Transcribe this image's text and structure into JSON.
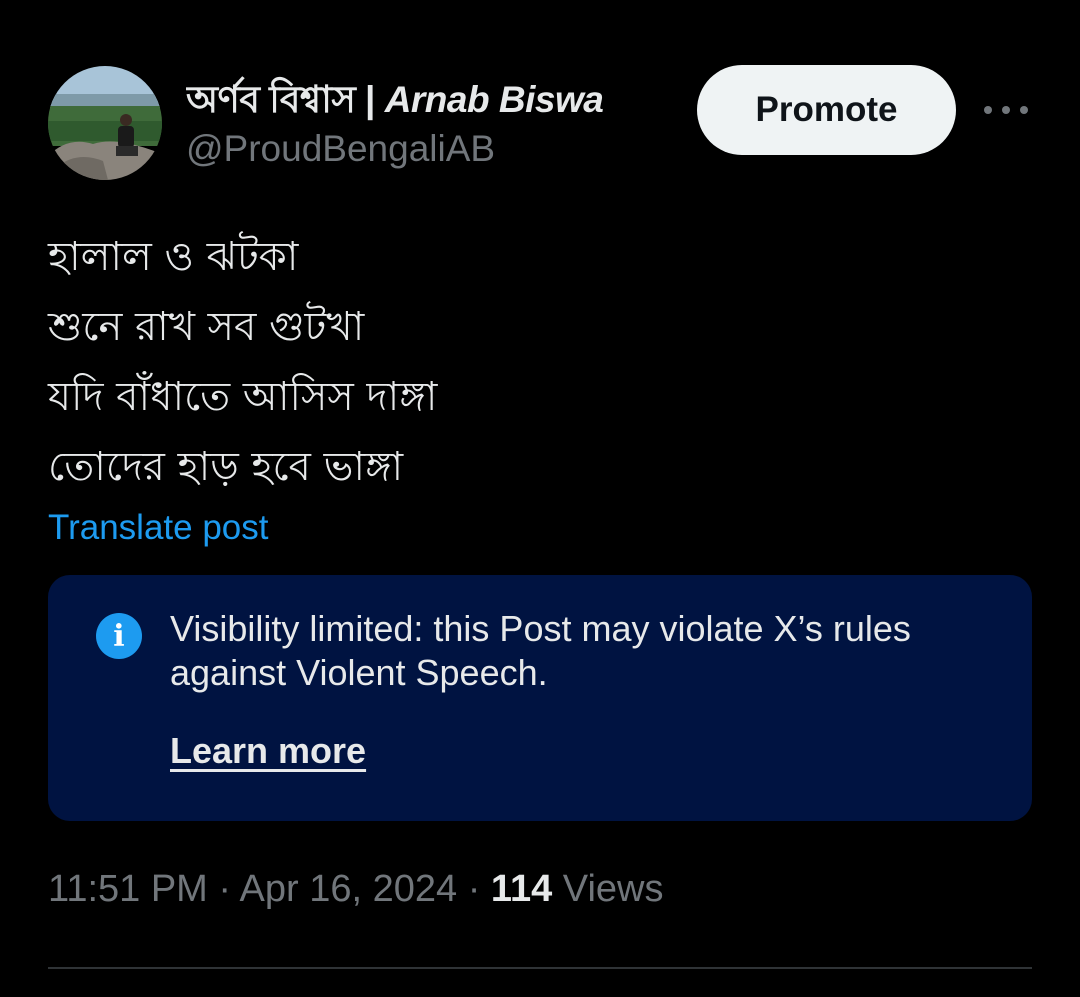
{
  "author": {
    "display_name_bn": "অর্ণব বিশ্বাস | ",
    "display_name_en": "Arnab Biswa",
    "handle": "@ProudBengaliAB",
    "avatar": "landscape-photo-avatar"
  },
  "actions": {
    "promote_label": "Promote",
    "more_icon": "more-horizontal-icon"
  },
  "post": {
    "lines": [
      "হালাল ও ঝটকা",
      "শুনে রাখ সব গুটখা",
      "যদি বাঁধাতে আসিস দাঙ্গা",
      "তোদের হাড় হবে ভাঙ্গা"
    ],
    "translate_label": "Translate post"
  },
  "notice": {
    "icon": "info-icon",
    "text": "Visibility limited: this Post may violate X’s rules against Violent Speech.",
    "learn_more_label": "Learn more"
  },
  "meta": {
    "time": "11:51 PM",
    "separator": " · ",
    "date": "Apr 16, 2024",
    "views_count": "114",
    "views_label": " Views"
  },
  "colors": {
    "background": "#000000",
    "link": "#1d9bf0",
    "notice_bg": "#001341",
    "muted": "#71767b"
  }
}
